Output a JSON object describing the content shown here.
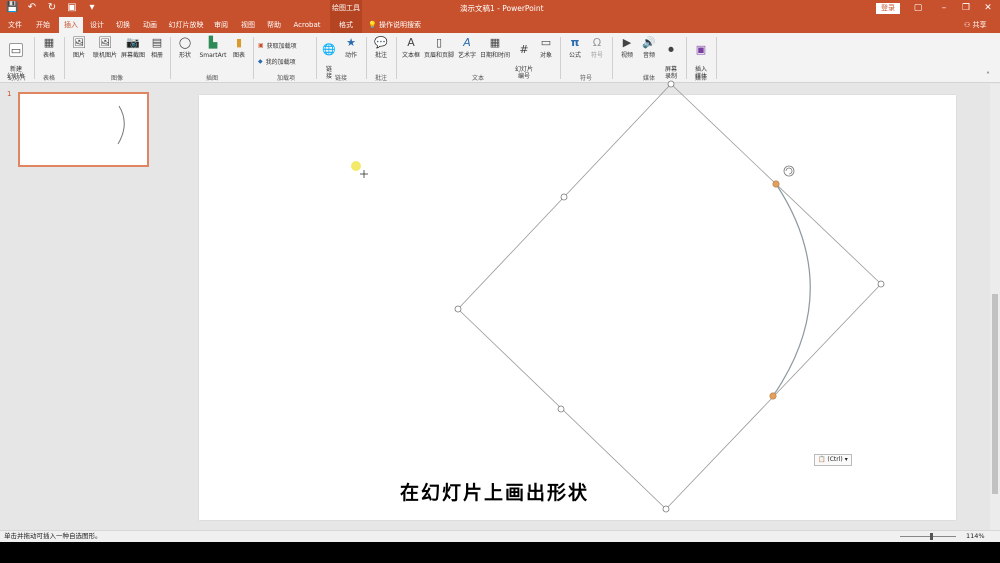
{
  "app": {
    "doc_title": "演示文稿1  -  PowerPoint",
    "context_tool_title": "绘图工具",
    "login_label": "登录",
    "share_label": "共享",
    "search_label": "操作说明搜索"
  },
  "tabs": [
    {
      "label": "文件"
    },
    {
      "label": "开始"
    },
    {
      "label": "插入"
    },
    {
      "label": "设计"
    },
    {
      "label": "切换"
    },
    {
      "label": "动画"
    },
    {
      "label": "幻灯片放映"
    },
    {
      "label": "审阅"
    },
    {
      "label": "视图"
    },
    {
      "label": "帮助"
    },
    {
      "label": "Acrobat"
    },
    {
      "label": "格式"
    }
  ],
  "ribbon": {
    "items": {
      "new_slide": "新建\n幻灯片",
      "table": "表格",
      "picture": "图片",
      "online_picture": "联机图片",
      "screenshot": "屏幕截图",
      "album": "相册",
      "shapes": "形状",
      "smartart": "SmartArt",
      "chart": "图表",
      "get_addins": "获取加载项",
      "my_addins": "我的加载项",
      "link": "链\n接",
      "action": "动作",
      "comment": "批注",
      "textbox": "文本框",
      "header_footer": "页眉和页脚",
      "wordart": "艺术字",
      "datetime": "日期和时间",
      "slide_number": "幻灯片\n编号",
      "object": "对象",
      "equation": "公式",
      "symbol": "符号",
      "video": "视频",
      "audio": "音频",
      "screen_record": "屏幕\n录制",
      "insert_media": "插入\n媒体"
    },
    "groups": {
      "slides": "幻灯片",
      "tables": "表格",
      "images": "图像",
      "illustrations": "插图",
      "addins": "加载项",
      "links": "链接",
      "comments": "批注",
      "text": "文本",
      "symbols": "符号",
      "media": "媒体",
      "media2": "媒体"
    }
  },
  "thumbnails": {
    "slide_number": "1"
  },
  "slide": {
    "caption": "在幻灯片上画出形状",
    "paste_options": "(Ctrl)"
  },
  "status": {
    "message": "单击并拖动可插入一种自选图形。",
    "zoom": "114%"
  },
  "colors": {
    "brand": "#c8512d",
    "handle_fill": "#ffffff",
    "adjust_handle": "#e0a060",
    "cursor_highlight": "#f3e85a"
  }
}
